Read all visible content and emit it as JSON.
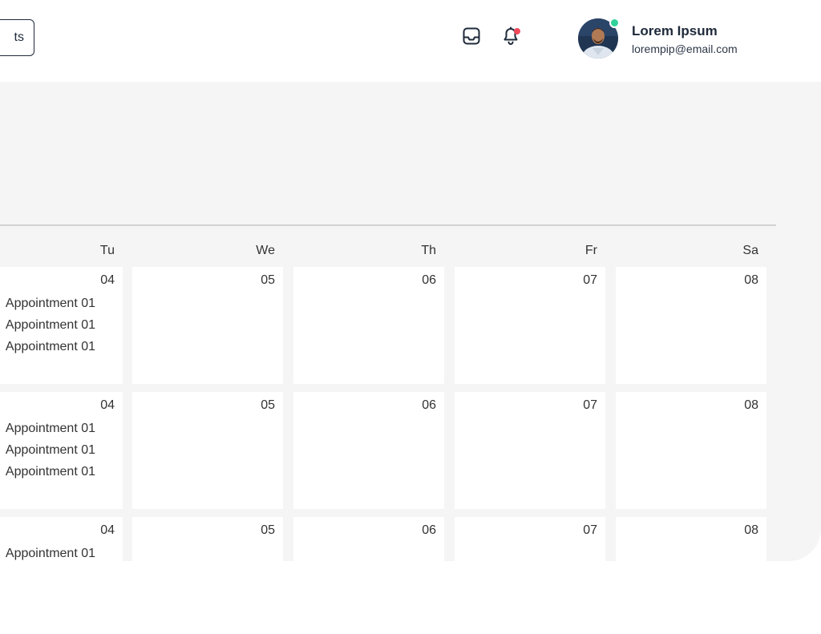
{
  "header": {
    "left_button_label": "ts",
    "icons": {
      "inbox": "inbox-icon",
      "bell": "bell-icon"
    },
    "user": {
      "name": "Lorem Ipsum",
      "email": "lorempip@email.com"
    }
  },
  "colors": {
    "text_dark": "#1e2a3a",
    "notification_dot": "#f04a5a",
    "online_dot": "#2fd29a",
    "content_bg": "#f5f5f5",
    "cell_bg": "#ffffff",
    "divider": "#d2d2d2"
  },
  "calendar": {
    "day_headers": [
      "Tu",
      "We",
      "Th",
      "Fr",
      "Sa"
    ],
    "weeks": [
      {
        "days": [
          {
            "date": "04",
            "appointments": [
              "Appointment 01",
              "Appointment 01",
              "Appointment 01"
            ]
          },
          {
            "date": "05",
            "appointments": []
          },
          {
            "date": "06",
            "appointments": []
          },
          {
            "date": "07",
            "appointments": []
          },
          {
            "date": "08",
            "appointments": []
          }
        ]
      },
      {
        "days": [
          {
            "date": "04",
            "appointments": [
              "Appointment 01",
              "Appointment 01",
              "Appointment 01"
            ]
          },
          {
            "date": "05",
            "appointments": []
          },
          {
            "date": "06",
            "appointments": []
          },
          {
            "date": "07",
            "appointments": []
          },
          {
            "date": "08",
            "appointments": []
          }
        ]
      },
      {
        "days": [
          {
            "date": "04",
            "appointments": [
              "Appointment 01"
            ]
          },
          {
            "date": "05",
            "appointments": []
          },
          {
            "date": "06",
            "appointments": []
          },
          {
            "date": "07",
            "appointments": []
          },
          {
            "date": "08",
            "appointments": []
          }
        ]
      }
    ]
  }
}
